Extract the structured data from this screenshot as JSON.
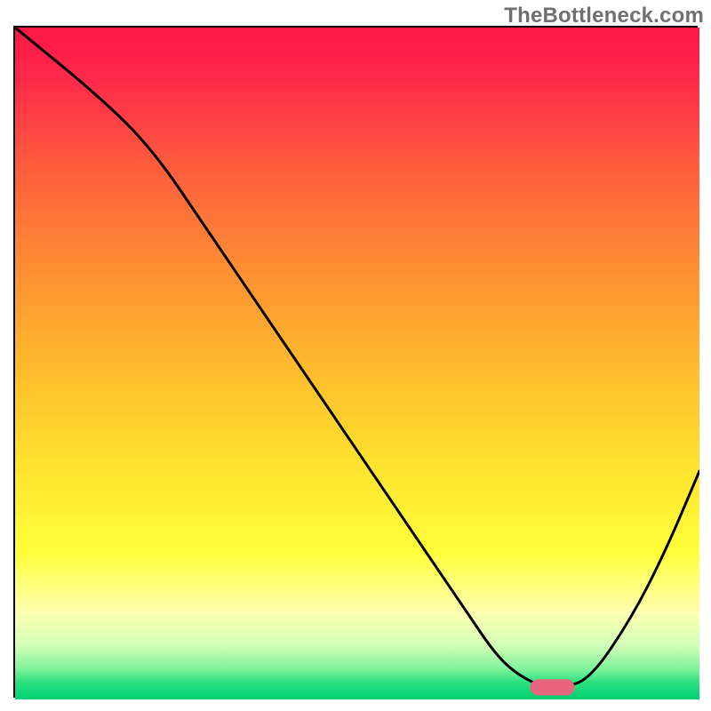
{
  "watermark": "TheBottleneck.com",
  "chart_data": {
    "type": "line",
    "title": "",
    "xlabel": "",
    "ylabel": "",
    "xlim": [
      0,
      100
    ],
    "ylim": [
      0,
      100
    ],
    "grid": false,
    "legend": false,
    "background": {
      "type": "vertical-gradient",
      "stops": [
        {
          "pos": 0.0,
          "color": "#ff1744"
        },
        {
          "pos": 0.08,
          "color": "#ff2a4a"
        },
        {
          "pos": 0.2,
          "color": "#ff5a3e"
        },
        {
          "pos": 0.35,
          "color": "#ff8b33"
        },
        {
          "pos": 0.5,
          "color": "#ffb92d"
        },
        {
          "pos": 0.65,
          "color": "#ffe22e"
        },
        {
          "pos": 0.78,
          "color": "#ffff3a"
        },
        {
          "pos": 0.87,
          "color": "#feffb0"
        },
        {
          "pos": 0.92,
          "color": "#d2ffb8"
        },
        {
          "pos": 0.955,
          "color": "#7ef29a"
        },
        {
          "pos": 0.975,
          "color": "#2be07f"
        },
        {
          "pos": 1.0,
          "color": "#00cf73"
        }
      ]
    },
    "series": [
      {
        "name": "curve",
        "color": "#000000",
        "stroke_width": 3,
        "x": [
          0,
          12,
          20,
          28,
          36,
          44,
          52,
          60,
          66,
          70,
          73,
          77,
          80,
          84,
          90,
          95,
          100
        ],
        "y": [
          100,
          90,
          82,
          70,
          58,
          46,
          34,
          22,
          13,
          7,
          4,
          1.8,
          1.8,
          3,
          12,
          22,
          34
        ]
      }
    ],
    "marker": {
      "name": "optimal-marker",
      "shape": "rounded-bar",
      "color": "#e8657d",
      "x_center": 78.5,
      "y": 1.8,
      "width": 6.5,
      "height": 2.4
    }
  }
}
